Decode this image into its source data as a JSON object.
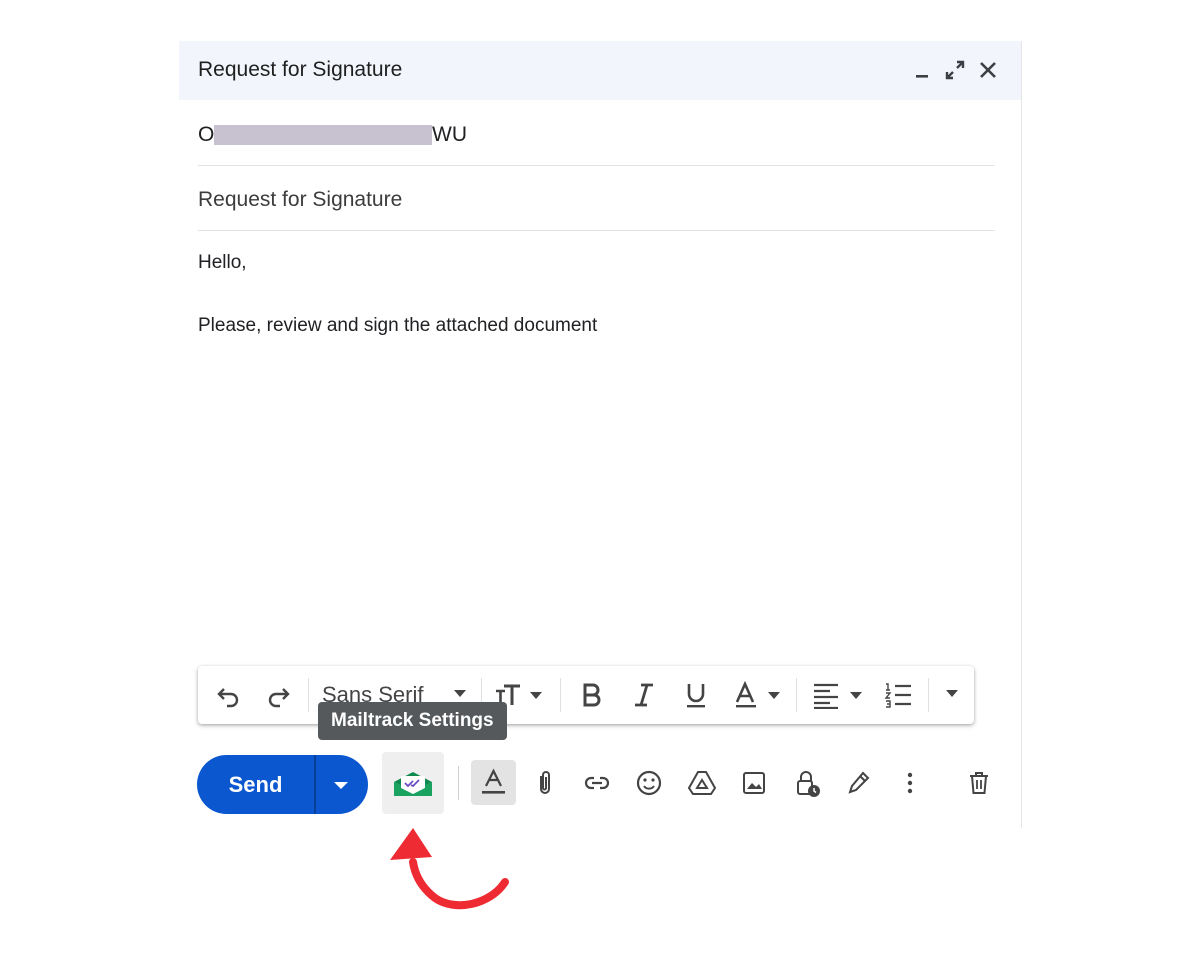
{
  "compose": {
    "title": "Request for Signature",
    "recipient_visible_start": "O",
    "recipient_visible_end": "WU",
    "subject": "Request for Signature",
    "body_lines": [
      "Hello,",
      "Please, review and sign the attached document"
    ]
  },
  "toolbar": {
    "font_family": "Sans Serif"
  },
  "tooltip": {
    "text": "Mailtrack Settings"
  },
  "actions": {
    "send_label": "Send"
  },
  "colors": {
    "send_blue": "#0b57d0",
    "header_bg": "#f2f6fc",
    "mailtrack_green": "#1aa260",
    "arrow_red": "#ee2a33"
  },
  "icons": [
    "minimize-icon",
    "expand-icon",
    "close-icon",
    "undo-icon",
    "redo-icon",
    "text-size-icon",
    "bold-icon",
    "italic-icon",
    "underline-icon",
    "text-color-icon",
    "align-icon",
    "numbered-list-icon",
    "more-formatting-icon",
    "mailtrack-icon",
    "formatting-options-icon",
    "attach-icon",
    "link-icon",
    "emoji-icon",
    "drive-icon",
    "photo-icon",
    "confidential-icon",
    "signature-icon",
    "more-options-icon",
    "trash-icon",
    "curved-arrow-icon"
  ]
}
